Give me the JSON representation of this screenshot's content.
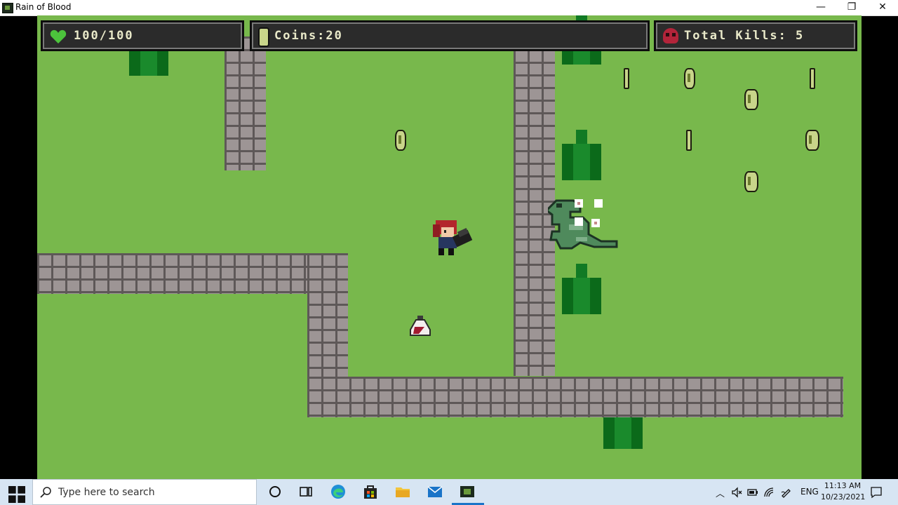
{
  "window": {
    "title": "Rain of Blood",
    "minimize": "—",
    "restore": "❐",
    "close": "✕"
  },
  "hud": {
    "health": "100/100",
    "coins": "Coins:20",
    "kills": "Total Kills: 5",
    "heart_color": "#4cc43c",
    "skull_color": "#b3243a"
  },
  "taskbar": {
    "search_placeholder": "Type here to search",
    "language": "ENG",
    "time": "11:13 AM",
    "date": "10/23/2021"
  }
}
